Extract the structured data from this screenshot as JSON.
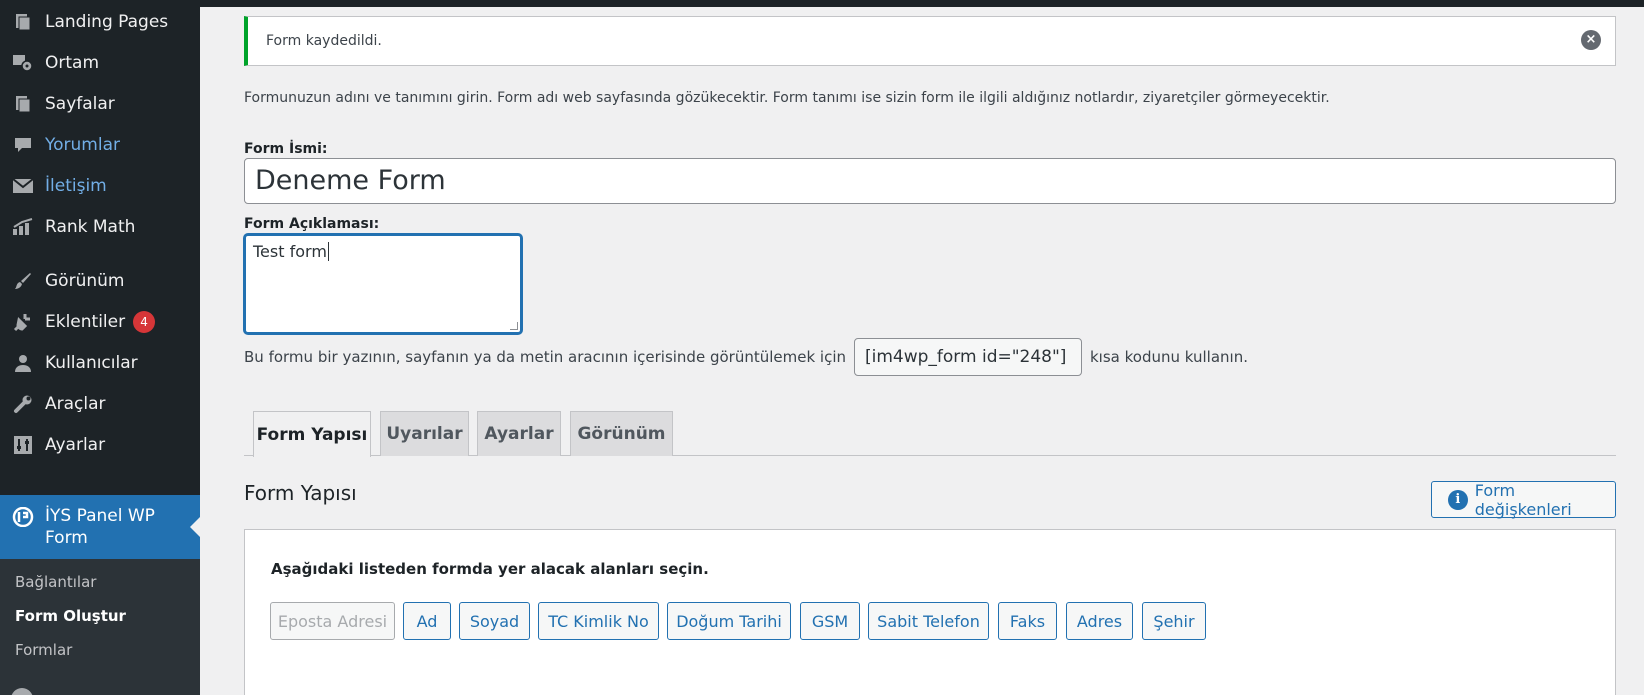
{
  "sidebar": {
    "items": [
      {
        "label": "Landing Pages",
        "icon": "pages-icon"
      },
      {
        "label": "Ortam",
        "icon": "media-icon"
      },
      {
        "label": "Sayfalar",
        "icon": "pages-icon"
      },
      {
        "label": "Yorumlar",
        "icon": "comments-icon"
      },
      {
        "label": "İletişim",
        "icon": "mail-icon"
      },
      {
        "label": "Rank Math",
        "icon": "rank-math-icon"
      },
      {
        "label": "Görünüm",
        "icon": "appearance-brush-icon"
      },
      {
        "label": "Eklentiler",
        "icon": "plugins-icon",
        "badge": "4"
      },
      {
        "label": "Kullanıcılar",
        "icon": "users-icon"
      },
      {
        "label": "Araçlar",
        "icon": "tools-wrench-icon"
      },
      {
        "label": "Ayarlar",
        "icon": "settings-sliders-icon"
      },
      {
        "label": "İYS Panel WP Form",
        "icon": "iys-panel-icon"
      }
    ],
    "submenu": [
      "Bağlantılar",
      "Form Oluştur",
      "Formlar"
    ]
  },
  "notice": {
    "text": "Form kaydedildi."
  },
  "intro_text": "Formunuzun adını ve tanımını girin. Form adı web sayfasında gözükecektir. Form tanımı ise sizin form ile ilgili aldığınız notlardır, ziyaretçiler görmeyecektir.",
  "form": {
    "name_label": "Form İsmi:",
    "name_value": "Deneme Form",
    "desc_label": "Form Açıklaması:",
    "desc_value": "Test form"
  },
  "shortcode": {
    "before": "Bu formu bir yazının, sayfanın ya da metin aracının içerisinde görüntülemek için",
    "code": "[im4wp_form id=\"248\"]",
    "after": "kısa kodunu kullanın."
  },
  "tabs": [
    "Form Yapısı",
    "Uyarılar",
    "Ayarlar",
    "Görünüm"
  ],
  "section": {
    "title": "Form Yapısı",
    "vars_button": "Form değişkenleri"
  },
  "panel": {
    "intro": "Aşağıdaki listeden formda yer alacak alanları seçin.",
    "fields": [
      "Eposta Adresi",
      "Ad",
      "Soyad",
      "TC Kimlik No",
      "Doğum Tarihi",
      "GSM",
      "Sabit Telefon",
      "Faks",
      "Adres",
      "Şehir"
    ]
  },
  "colors": {
    "accent": "#2271b1",
    "sidebar": "#1d2327",
    "success": "#00a32a",
    "badge": "#d63638"
  }
}
